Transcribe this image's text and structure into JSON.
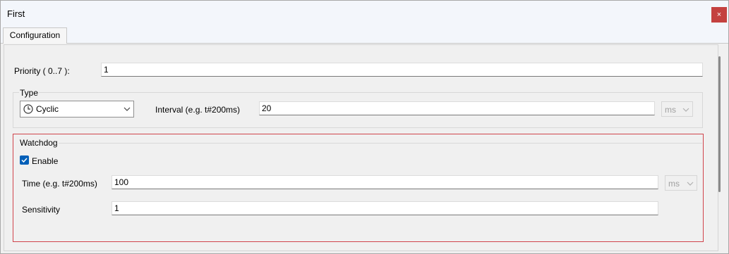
{
  "window": {
    "title": "First",
    "close_label": "×"
  },
  "tabs": [
    {
      "label": "Configuration"
    }
  ],
  "priority": {
    "label": "Priority ( 0..7  ):",
    "value": "1"
  },
  "type_group": {
    "label": "Type",
    "type_select": {
      "value": "Cyclic",
      "icon": "clock-icon"
    },
    "interval": {
      "label": "Interval (e.g. t#200ms)",
      "value": "20",
      "unit": "ms"
    }
  },
  "watchdog": {
    "label": "Watchdog",
    "enable": {
      "label": "Enable",
      "checked": true
    },
    "time": {
      "label": "Time (e.g. t#200ms)",
      "value": "100",
      "unit": "ms"
    },
    "sensitivity": {
      "label": "Sensitivity",
      "value": "1"
    }
  },
  "colors": {
    "close": "#c4413f",
    "accent": "#005fb8",
    "watchdog_border": "#d0444b"
  }
}
